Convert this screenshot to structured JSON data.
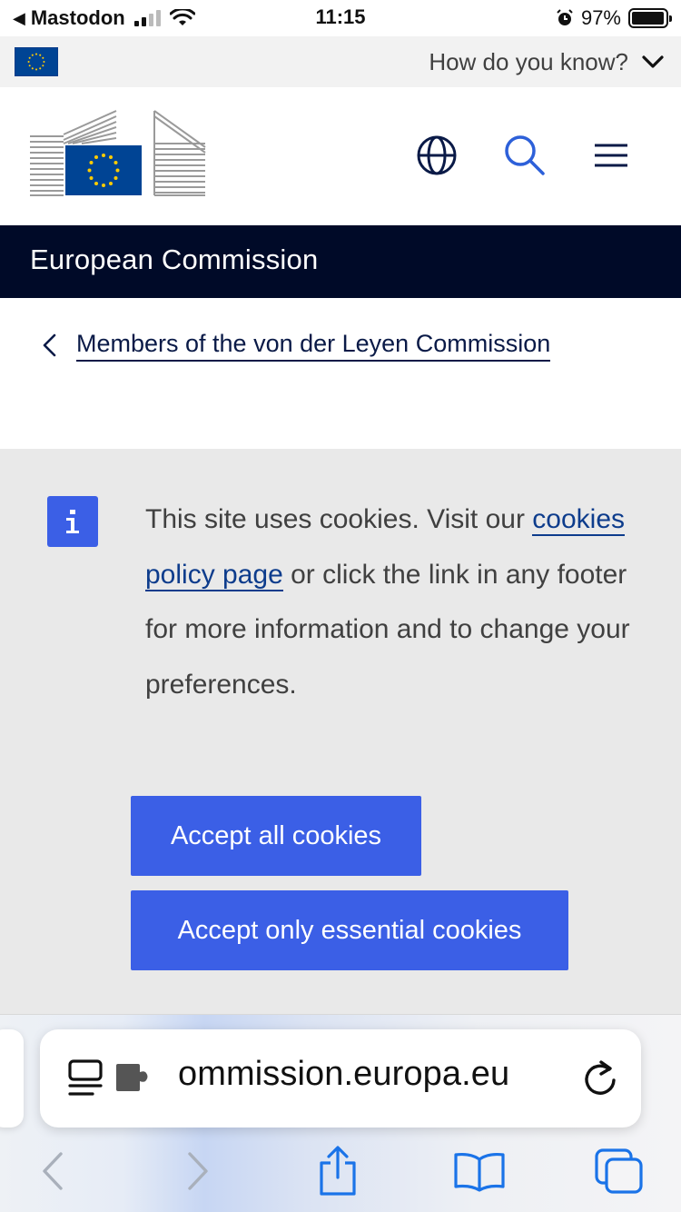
{
  "status_bar": {
    "back_app": "Mastodon",
    "time": "11:15",
    "battery_percent": "97%",
    "battery_level": 0.97
  },
  "banner": {
    "how_do_you_know": "How do you know?"
  },
  "header": {
    "icons": [
      "eu-commission-logo",
      "globe-icon",
      "search-icon",
      "menu-icon"
    ]
  },
  "title_bar": {
    "title": "European Commission"
  },
  "breadcrumb": {
    "label": "Members of the von der Leyen Commission"
  },
  "cookie_banner": {
    "text_before_link": "This site uses cookies. Visit our ",
    "link_text": "cookies policy page",
    "text_after_link": " or click the link in any footer for more information and to change your preferences.",
    "accept_all_label": "Accept all cookies",
    "accept_essential_label": "Accept only essential cookies"
  },
  "browser": {
    "url": "ommission.europa.eu"
  },
  "colors": {
    "primary_blue": "#3b5fe6",
    "dark_navy": "#000a28",
    "eu_blue": "#004494",
    "eu_gold": "#ffcc00",
    "safari_blue": "#1a73e8"
  }
}
